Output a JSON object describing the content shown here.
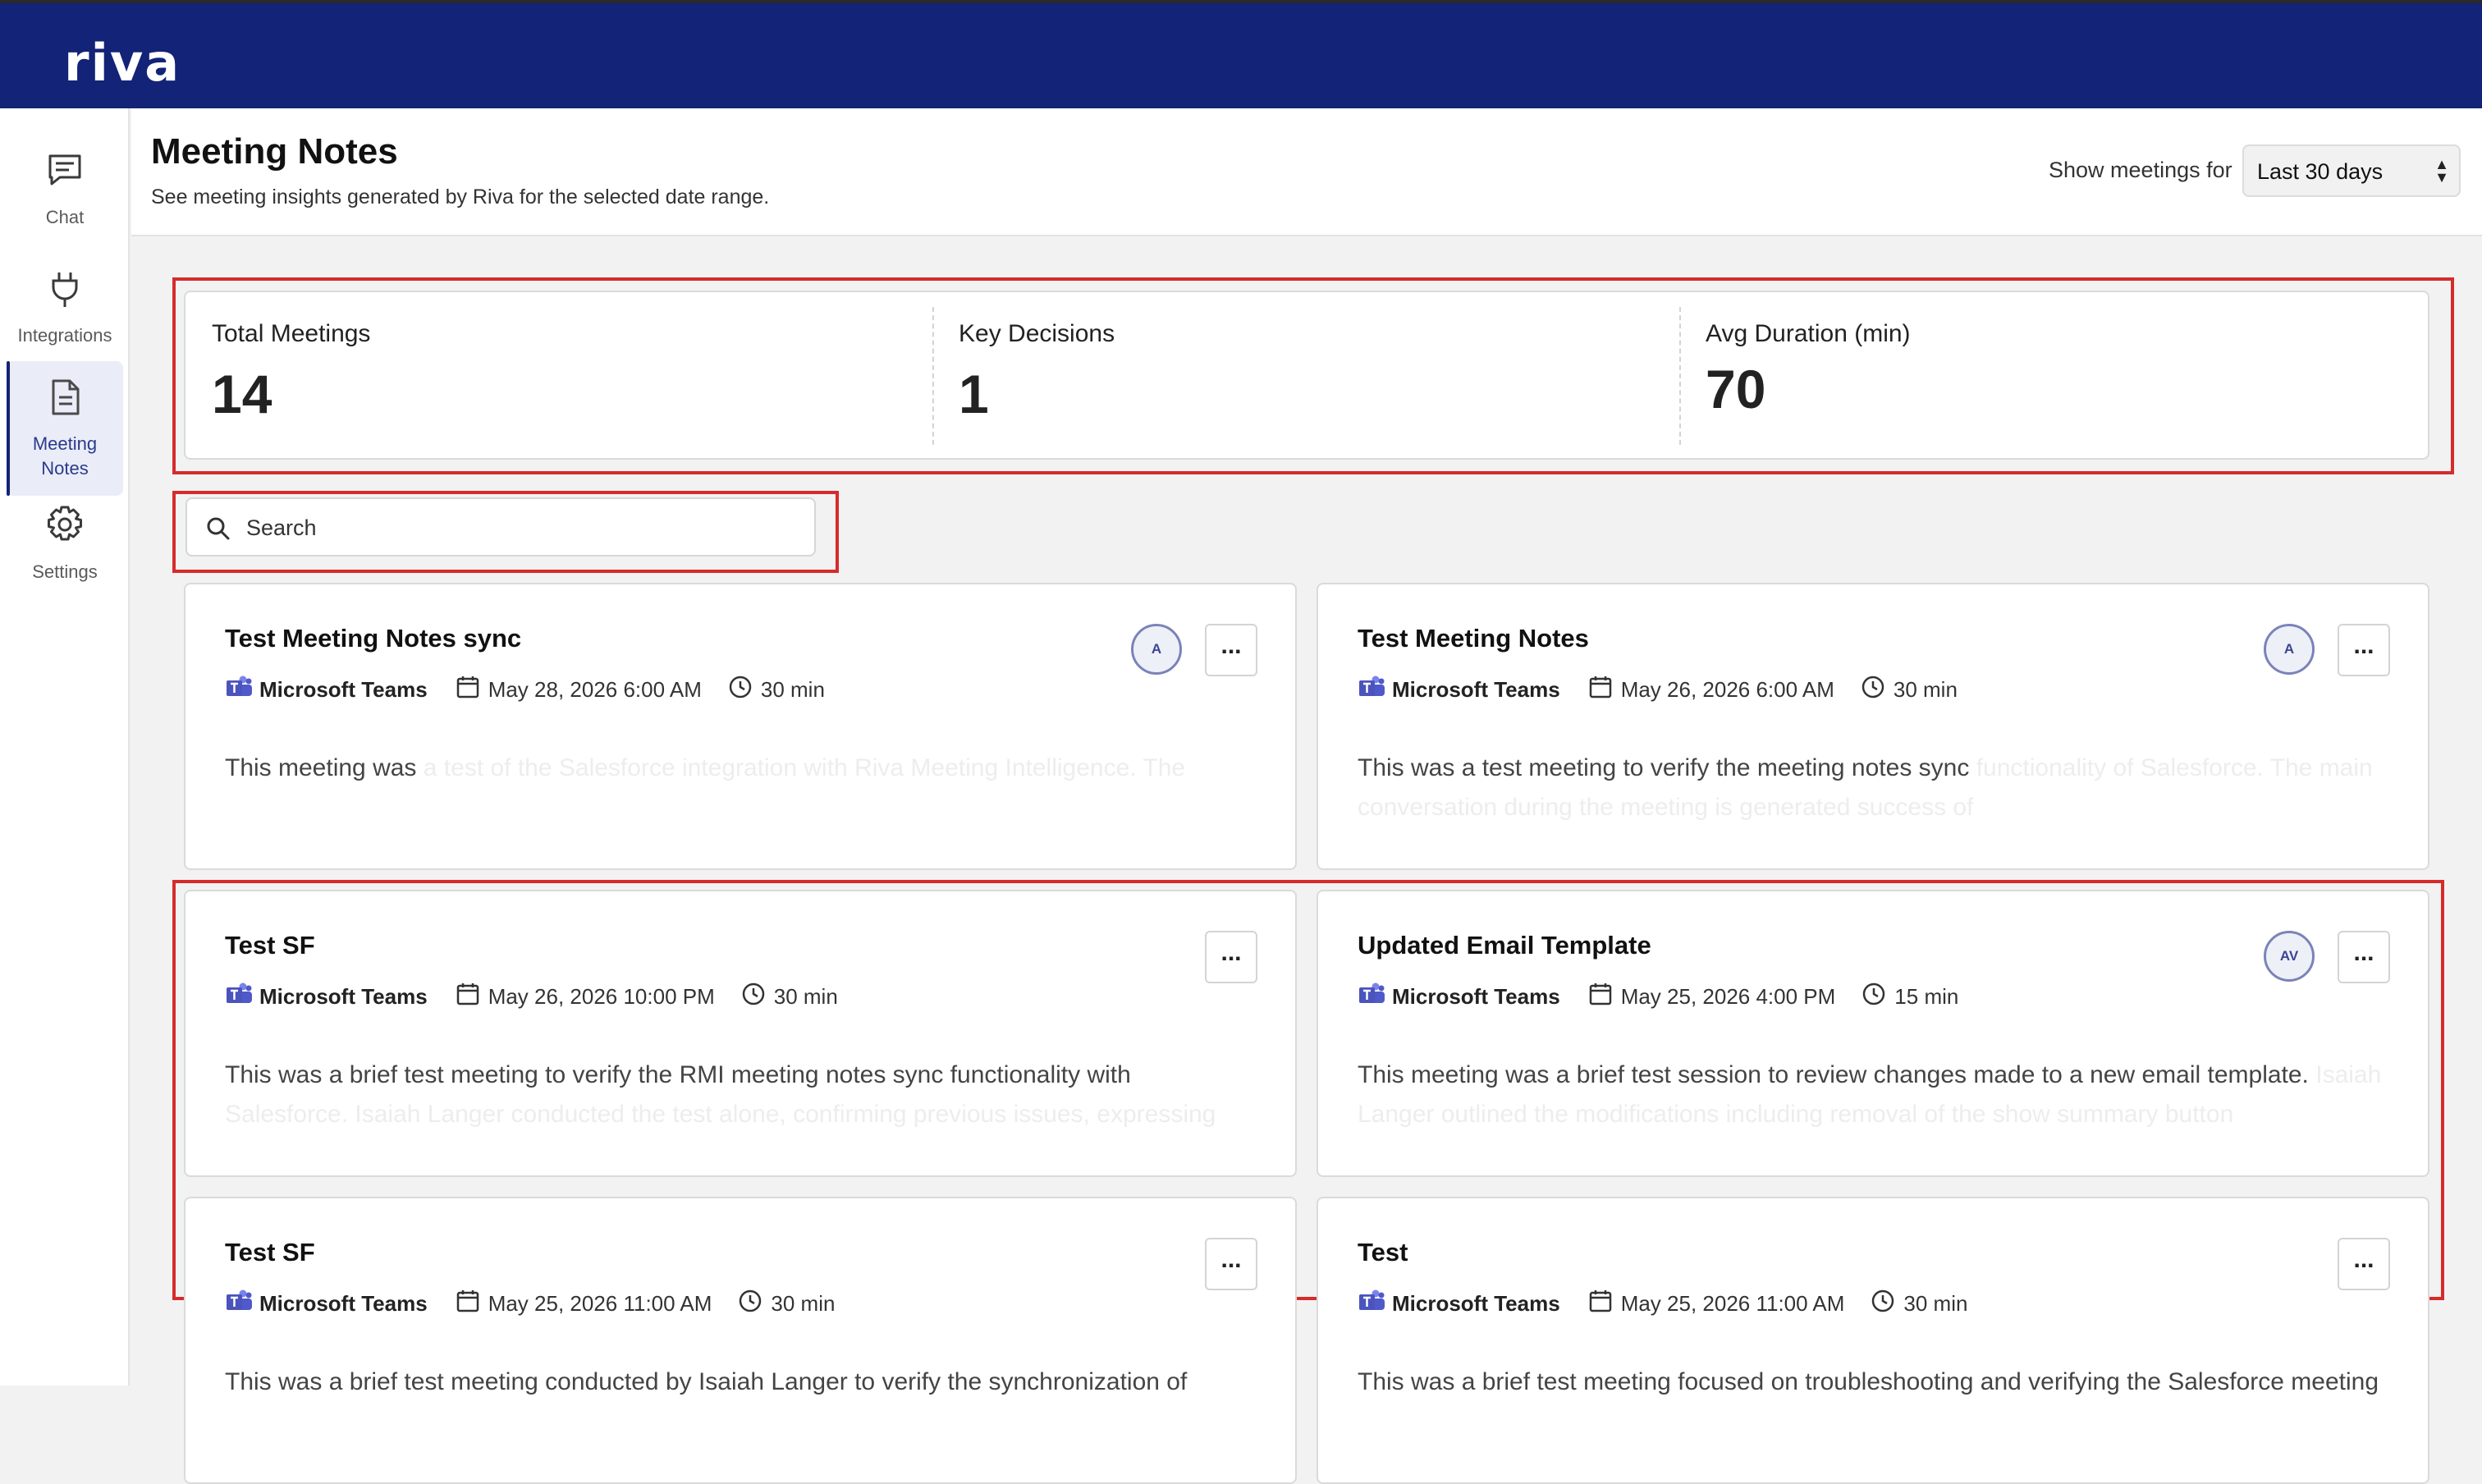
{
  "app": {
    "logo": "riva"
  },
  "sidebar": {
    "items": [
      {
        "label": "Chat",
        "icon": "chat-icon"
      },
      {
        "label": "Integrations",
        "icon": "plug-icon"
      },
      {
        "label": "Meeting Notes",
        "icon": "document-icon",
        "active": true
      },
      {
        "label": "Settings",
        "icon": "gear-icon"
      }
    ]
  },
  "header": {
    "title": "Meeting Notes",
    "subtitle": "See meeting insights generated by Riva for the selected date range.",
    "range_label": "Show meetings for",
    "range_value": "Last 30 days"
  },
  "stats": [
    {
      "label": "Total Meetings",
      "value": "14"
    },
    {
      "label": "Key Decisions",
      "value": "1"
    },
    {
      "label": "Avg Duration (min)",
      "value": "70"
    }
  ],
  "search": {
    "placeholder": "Search"
  },
  "meetings": [
    {
      "title": "Test Meeting Notes sync",
      "platform": "Microsoft Teams",
      "date": "May 28, 2026 6:00 AM",
      "duration": "30 min",
      "avatar": "A",
      "summary": "This meeting was",
      "summary_faded": "a test of the Salesforce integration with Riva Meeting Intelligence. The"
    },
    {
      "title": "Test Meeting Notes",
      "platform": "Microsoft Teams",
      "date": "May 26, 2026 6:00 AM",
      "duration": "30 min",
      "avatar": "A",
      "summary": "This was a test meeting to verify the meeting notes sync",
      "summary_faded": "functionality of Salesforce. The main conversation during the meeting is generated success of"
    },
    {
      "title": "Test SF",
      "platform": "Microsoft Teams",
      "date": "May 26, 2026 10:00 PM",
      "duration": "30 min",
      "avatar": "",
      "summary": "This was a brief test meeting to verify the RMI meeting notes sync functionality with",
      "summary_faded": "Salesforce. Isaiah Langer conducted the test alone, confirming previous issues, expressing"
    },
    {
      "title": "Updated Email Template",
      "platform": "Microsoft Teams",
      "date": "May 25, 2026 4:00 PM",
      "duration": "15 min",
      "avatar": "AV",
      "summary": "This meeting was a brief test session to review changes made to a new email template.",
      "summary_faded": "Isaiah Langer outlined the modifications including removal of the show summary button"
    },
    {
      "title": "Test SF",
      "platform": "Microsoft Teams",
      "date": "May 25, 2026 11:00 AM",
      "duration": "30 min",
      "avatar": "",
      "summary": "This was a brief test meeting conducted by Isaiah Langer to verify the synchronization of",
      "summary_faded": ""
    },
    {
      "title": "Test",
      "platform": "Microsoft Teams",
      "date": "May 25, 2026 11:00 AM",
      "duration": "30 min",
      "avatar": "",
      "summary": "This was a brief test meeting focused on troubleshooting and verifying the Salesforce meeting",
      "summary_faded": ""
    }
  ],
  "more_label": "..."
}
